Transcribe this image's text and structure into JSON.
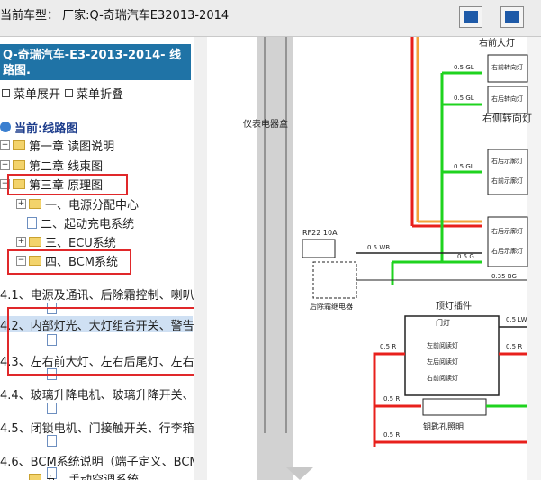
{
  "header": {
    "car_model_label": "当前车型：  厂家:Q-奇瑞汽车E32013-2014"
  },
  "sidebar": {
    "title": "Q-奇瑞汽车-E3-2013-2014- 线路图.",
    "expand_label": "菜单展开",
    "collapse_label": "菜单折叠",
    "current_label": "当前:线路图",
    "items": [
      {
        "label": "第一章 读图说明"
      },
      {
        "label": "第二章 线束图"
      },
      {
        "label": "第三章 原理图"
      },
      {
        "label": "一、电源分配中心"
      },
      {
        "label": "二、起动充电系统"
      },
      {
        "label": "三、ECU系统"
      },
      {
        "label": "四、BCM系统"
      },
      {
        "label": "4.1、电源及通讯、后除霜控制、喇叭"
      },
      {
        "label": "4.2、内部灯光、大灯组合开关、警告"
      },
      {
        "label": "4.3、左右前大灯、左右后尾灯、左右"
      },
      {
        "label": "4.4、玻璃升降电机、玻璃升降开关、"
      },
      {
        "label": "4.5、闭锁电机、门接触开关、行李箱"
      },
      {
        "label": "4.6、BCM系统说明（端子定义、BCM"
      },
      {
        "label": "五、手动空调系统"
      }
    ]
  },
  "diagram": {
    "vertical_label": "仪表电器盒",
    "fuse_label": "RF22  10A",
    "relay_label": "后除霜继电器",
    "wire_labels": [
      "0.5 GL",
      "0.5 GL",
      "0.5 GL",
      "0.5 G",
      "0.5 WB",
      "0.5 G",
      "0.35 BG",
      "0.5 R",
      "0.5 R",
      "0.5 R",
      "0.5 LW",
      "0.5 R"
    ],
    "right_lamp_label": "右侧转向灯",
    "right_front_label": "右前大灯",
    "lamp_box_labels": [
      "右前转向灯",
      "右后转向灯",
      "右后示廓灯",
      "右前示廓灯",
      "右后示廓灯",
      "右后示廓灯"
    ],
    "dome_label": "顶灯插件",
    "dome_inner": [
      "门灯",
      "左前阅读灯",
      "左后阅读灯",
      "右前阅读灯"
    ],
    "key_label": "钥匙孔照明"
  },
  "colors": {
    "sidebar_title_bg": "#1f73a6",
    "highlight_red": "#e0282a",
    "wire_green": "#1fd31f",
    "wire_red": "#e8201c",
    "wire_orange": "#f2a23a",
    "button_icon": "#1e5aa8"
  }
}
